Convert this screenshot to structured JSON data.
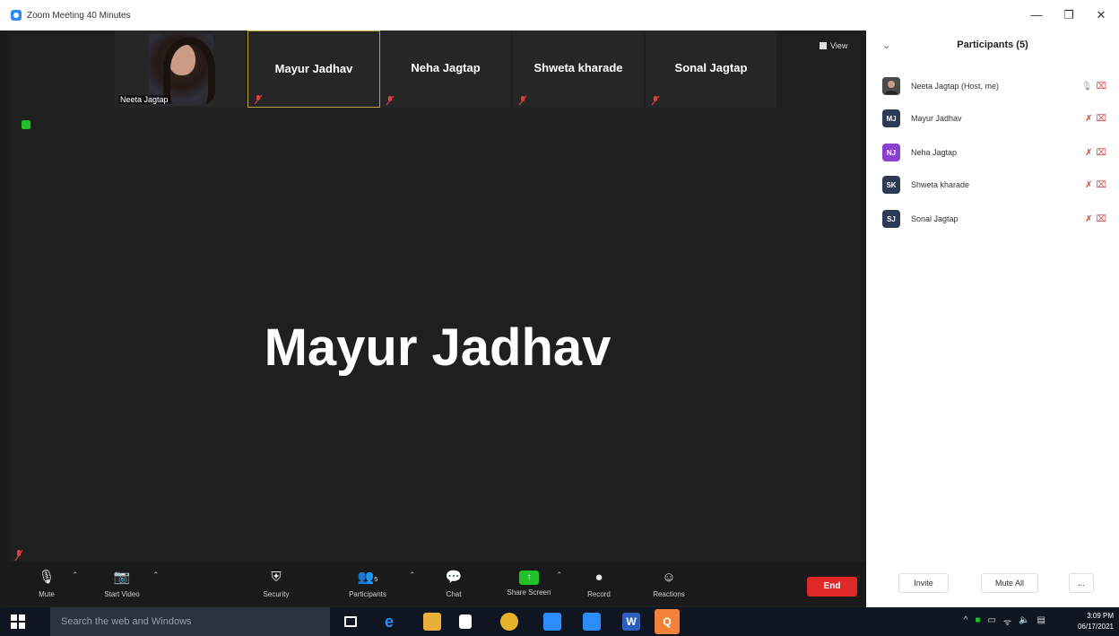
{
  "window": {
    "title": "Zoom Meeting 40 Minutes",
    "minimize": "—",
    "maximize": "❐",
    "close": "✕"
  },
  "strip": {
    "self": {
      "name": "Neeta Jagtap"
    },
    "tiles": [
      {
        "name": "Mayur Jadhav",
        "active": true
      },
      {
        "name": "Neha Jagtap",
        "active": false
      },
      {
        "name": "Shweta kharade",
        "active": false
      },
      {
        "name": "Sonal Jagtap",
        "active": false
      }
    ],
    "view_label": "View"
  },
  "active_speaker": "Mayur Jadhav",
  "toolbar": {
    "mute": "Mute",
    "start_video": "Start Video",
    "security": "Security",
    "participants": "Participants",
    "participants_count": "5",
    "chat": "Chat",
    "share_screen": "Share Screen",
    "record": "Record",
    "reactions": "Reactions",
    "end": "End"
  },
  "panel": {
    "title": "Participants (5)",
    "participants": [
      {
        "initials": "",
        "name": "Neeta Jagtap (Host, me)",
        "color": "#555555"
      },
      {
        "initials": "MJ",
        "name": "Mayur Jadhav",
        "color": "#2b3a55"
      },
      {
        "initials": "NJ",
        "name": "Neha Jagtap",
        "color": "#8a3fcf"
      },
      {
        "initials": "SK",
        "name": "Shweta kharade",
        "color": "#2b3a55"
      },
      {
        "initials": "SJ",
        "name": "Sonal Jagtap",
        "color": "#2b3a55"
      }
    ],
    "invite": "Invite",
    "mute_all": "Mute All",
    "more": "..."
  },
  "taskbar": {
    "search_placeholder": "Search the web and Windows",
    "time": "3:09 PM",
    "date": "06/17/2021"
  },
  "colors": {
    "end": "#e02828",
    "share": "#21c02a",
    "accent": "#2d8cff",
    "mute_red": "#e03c3c"
  }
}
